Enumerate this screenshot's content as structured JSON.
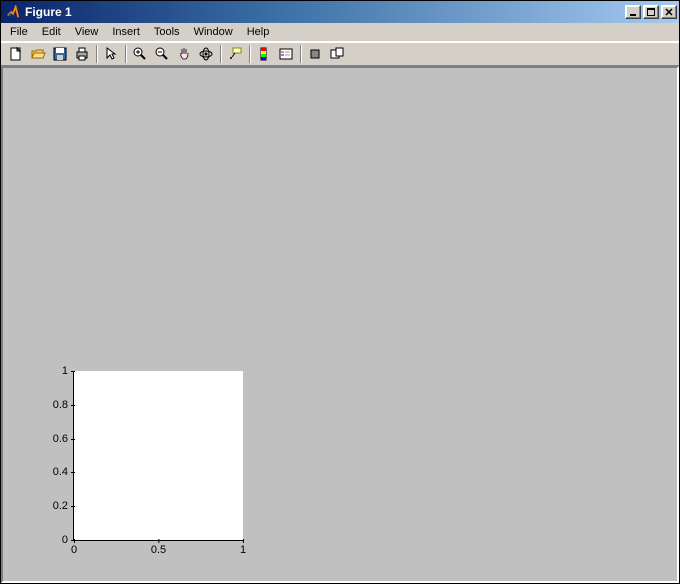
{
  "window": {
    "title": "Figure 1"
  },
  "menubar": {
    "items": [
      {
        "label": "File"
      },
      {
        "label": "Edit"
      },
      {
        "label": "View"
      },
      {
        "label": "Insert"
      },
      {
        "label": "Tools"
      },
      {
        "label": "Window"
      },
      {
        "label": "Help"
      }
    ]
  },
  "toolbar": {
    "new": "New Figure",
    "open": "Open File",
    "save": "Save Figure",
    "print": "Print Figure",
    "pointer": "Edit Plot",
    "zoomin": "Zoom In",
    "zoomout": "Zoom Out",
    "pan": "Pan",
    "rotate": "Rotate 3D",
    "datacursor": "Data Cursor",
    "colorbar": "Insert Colorbar",
    "legend": "Insert Legend",
    "hide": "Hide Plot Tools",
    "show": "Show Plot Tools"
  },
  "chart_data": {
    "type": "line",
    "series": [],
    "x_ticks": [
      {
        "pos": 0.0,
        "label": "0"
      },
      {
        "pos": 0.5,
        "label": "0.5"
      },
      {
        "pos": 1.0,
        "label": "1"
      }
    ],
    "y_ticks": [
      {
        "pos": 0.0,
        "label": "0"
      },
      {
        "pos": 0.2,
        "label": "0.2"
      },
      {
        "pos": 0.4,
        "label": "0.4"
      },
      {
        "pos": 0.6,
        "label": "0.6"
      },
      {
        "pos": 0.8,
        "label": "0.8"
      },
      {
        "pos": 1.0,
        "label": "1"
      }
    ],
    "xlim": [
      0,
      1
    ],
    "ylim": [
      0,
      1
    ],
    "title": "",
    "xlabel": "",
    "ylabel": ""
  }
}
